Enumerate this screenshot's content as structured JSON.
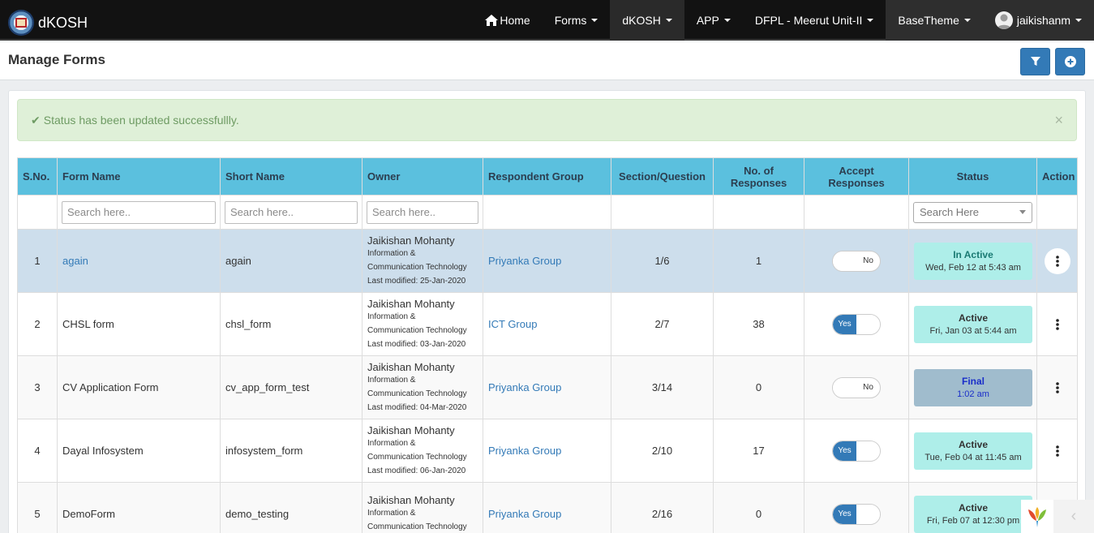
{
  "nav": {
    "brand": "dKOSH",
    "items": [
      {
        "label": "Home",
        "icon": "home-icon"
      },
      {
        "label": "Forms"
      },
      {
        "label": "dKOSH"
      },
      {
        "label": "APP"
      },
      {
        "label": "DFPL - Meerut Unit-II"
      },
      {
        "label": "BaseTheme"
      },
      {
        "label": "jaikishanm",
        "icon": "user-avatar-icon"
      }
    ]
  },
  "page": {
    "title": "Manage Forms",
    "filter_icon": "filter-icon",
    "add_icon": "plus-circle-icon"
  },
  "alert": {
    "message": "Status has been updated successfullly.",
    "close": "×"
  },
  "table": {
    "headers": [
      "S.No.",
      "Form Name",
      "Short Name",
      "Owner",
      "Respondent Group",
      "Section/Question",
      "No. of Responses",
      "Accept Responses",
      "Status",
      "Action"
    ],
    "search_placeholder": "Search here..",
    "status_filter_placeholder": "Search Here",
    "rows": [
      {
        "sno": "1",
        "form_name": "again",
        "short_name": "again",
        "owner": "Jaikishan Mohanty",
        "dept": "Information &",
        "dept2": "Communication Technology",
        "modified": "Last modified: 25-Jan-2020",
        "group": "Priyanka Group",
        "sections": "1/6",
        "responses": "1",
        "accept": "No",
        "status": "In Active",
        "status_time": "Wed, Feb 12 at 5:43 am"
      },
      {
        "sno": "2",
        "form_name": "CHSL form",
        "short_name": "chsl_form",
        "owner": "Jaikishan Mohanty",
        "dept": "Information &",
        "dept2": "Communication Technology",
        "modified": "Last modified: 03-Jan-2020",
        "group": "ICT Group",
        "sections": "2/7",
        "responses": "38",
        "accept": "Yes",
        "status": "Active",
        "status_time": "Fri, Jan 03 at 5:44 am"
      },
      {
        "sno": "3",
        "form_name": "CV Application Form",
        "short_name": "cv_app_form_test",
        "owner": "Jaikishan Mohanty",
        "dept": "Information &",
        "dept2": "Communication Technology",
        "modified": "Last modified: 04-Mar-2020",
        "group": "Priyanka Group",
        "sections": "3/14",
        "responses": "0",
        "accept": "No",
        "status": "Final",
        "status_time": "1:02 am"
      },
      {
        "sno": "4",
        "form_name": "Dayal Infosystem",
        "short_name": "infosystem_form",
        "owner": "Jaikishan Mohanty",
        "dept": "Information &",
        "dept2": "Communication Technology",
        "modified": "Last modified: 06-Jan-2020",
        "group": "Priyanka Group",
        "sections": "2/10",
        "responses": "17",
        "accept": "Yes",
        "status": "Active",
        "status_time": "Tue, Feb 04 at 11:45 am"
      },
      {
        "sno": "5",
        "form_name": "DemoForm",
        "short_name": "demo_testing",
        "owner": "Jaikishan Mohanty",
        "dept": "Information &",
        "dept2": "Communication Technology",
        "modified": "",
        "group": "Priyanka Group",
        "sections": "2/16",
        "responses": "0",
        "accept": "Yes",
        "status": "Active",
        "status_time": "Fri, Feb 07 at 12:30 pm"
      }
    ]
  },
  "corner": {
    "logo_icon": "app-leaf-logo-icon",
    "prev": "‹"
  },
  "colors": {
    "navbar": "#121212",
    "header_row": "#5bc0de",
    "primary": "#337ab7",
    "alert_bg": "#dff0d8",
    "status_active": "#aeeee9",
    "status_final": "#a0bccd",
    "row_highlight": "#cddeec"
  }
}
